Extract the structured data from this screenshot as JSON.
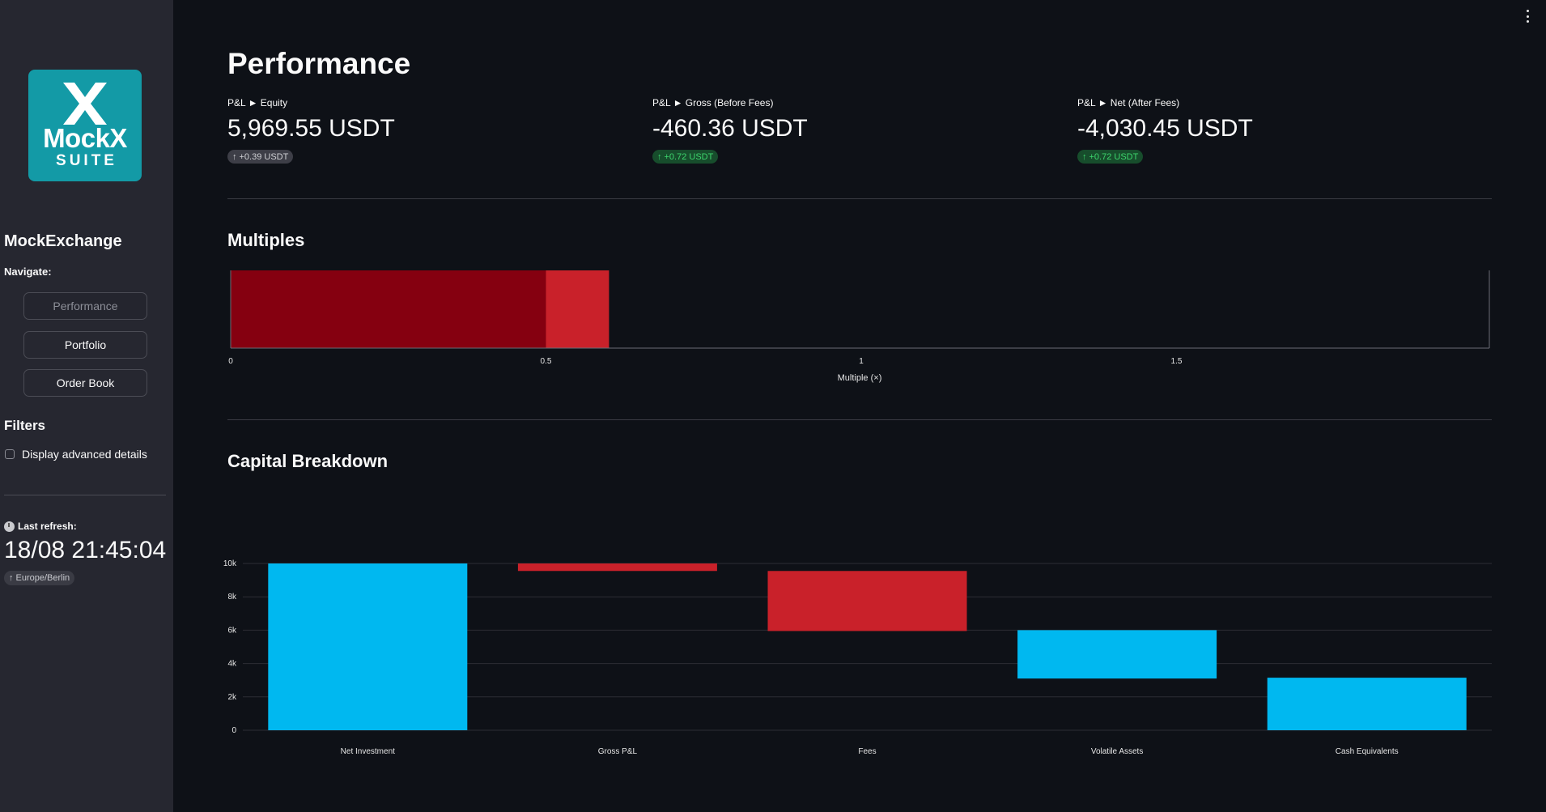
{
  "sidebar": {
    "logo": {
      "name": "MockX",
      "sub": "SUITE",
      "color": "#139aa6"
    },
    "app_name": "MockExchange",
    "navigate_label": "Navigate:",
    "nav_items": [
      {
        "label": "Performance",
        "active": true
      },
      {
        "label": "Portfolio",
        "active": false
      },
      {
        "label": "Order Book",
        "active": false
      }
    ],
    "filters_label": "Filters",
    "advanced_checkbox": {
      "label": "Display advanced details",
      "checked": false
    },
    "last_refresh_label": "Last refresh:",
    "last_refresh_time": "18/08 21:45:04",
    "timezone": "Europe/Berlin"
  },
  "main": {
    "title": "Performance",
    "metrics": [
      {
        "label": "P&L ► Equity",
        "value": "5,969.55 USDT",
        "delta": "+0.39 USDT",
        "delta_style": "gray"
      },
      {
        "label": "P&L ► Gross (Before Fees)",
        "value": "-460.36 USDT",
        "delta": "+0.72 USDT",
        "delta_style": "green"
      },
      {
        "label": "P&L ► Net (After Fees)",
        "value": "-4,030.45 USDT",
        "delta": "+0.72 USDT",
        "delta_style": "green"
      }
    ],
    "multiples_title": "Multiples",
    "capital_title": "Capital Breakdown"
  },
  "chart_data": [
    {
      "type": "bar",
      "orientation": "horizontal",
      "stacked": true,
      "series": [
        {
          "values": [
            0.5
          ],
          "color": "#850010"
        },
        {
          "values": [
            0.1
          ],
          "color": "#c9212a"
        }
      ],
      "xlabel": "Multiple (×)",
      "xlim": [
        0,
        2
      ],
      "xticks": [
        "0",
        "0.5",
        "1",
        "1.5"
      ]
    },
    {
      "type": "bar",
      "subtype": "waterfall",
      "categories": [
        "Net Investment",
        "Gross P&L",
        "Fees",
        "Volatile Assets",
        "Cash Equivalents"
      ],
      "bars": [
        {
          "base": 0,
          "top": 10000,
          "color": "#00b8f0"
        },
        {
          "base": 9550,
          "top": 10000,
          "color": "#c9212a"
        },
        {
          "base": 5950,
          "top": 9550,
          "color": "#c9212a"
        },
        {
          "base": 3100,
          "top": 6000,
          "color": "#00b8f0"
        },
        {
          "base": 0,
          "top": 3150,
          "color": "#00b8f0"
        }
      ],
      "ylim": [
        0,
        10000
      ],
      "yticks": [
        "0",
        "2k",
        "4k",
        "6k",
        "8k",
        "10k"
      ],
      "grid": true
    }
  ]
}
